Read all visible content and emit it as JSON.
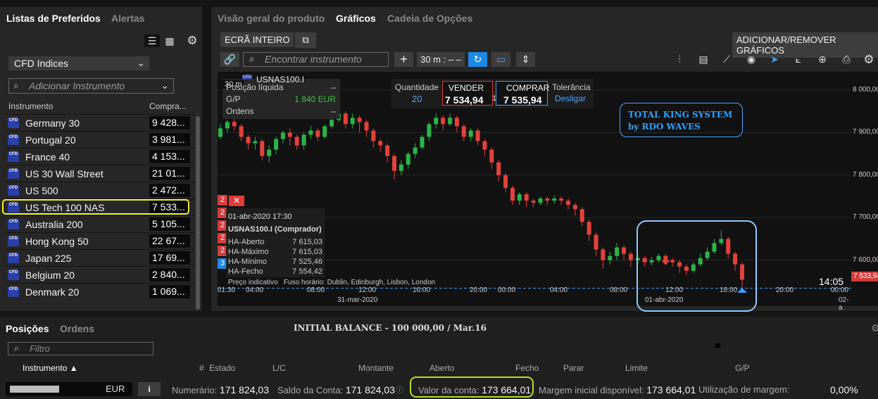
{
  "left": {
    "tabs": [
      "Listas de Preferidos",
      "Alertas"
    ],
    "list_select": "CFD Indices",
    "search_placeholder": "Adicionar Instrumento",
    "col_instrument": "Instrumento",
    "col_buy": "Compra...",
    "cfd_badge": "CFD",
    "items": [
      {
        "name": "Germany 30",
        "price": "9 428..."
      },
      {
        "name": "Portugal 20",
        "price": "3 981..."
      },
      {
        "name": "France 40",
        "price": "4 153..."
      },
      {
        "name": "US 30 Wall Street",
        "price": "21 01..."
      },
      {
        "name": "US 500",
        "price": "2 472..."
      },
      {
        "name": "US Tech 100 NAS",
        "price": "7 533..."
      },
      {
        "name": "Australia 200",
        "price": "5 105..."
      },
      {
        "name": "Hong Kong 50",
        "price": "22 67..."
      },
      {
        "name": "Japan 225",
        "price": "17 69..."
      },
      {
        "name": "Belgium 20",
        "price": "2 840..."
      },
      {
        "name": "Denmark 20",
        "price": "1 069..."
      }
    ]
  },
  "right": {
    "tabs": [
      "Visão geral do produto",
      "Gráficos",
      "Cadeia de Opções"
    ],
    "fullscreen_label": "ECRÃ INTEIRO",
    "add_remove_label": "ADICIONAR/REMOVER GRÁFICOS",
    "search_placeholder": "Encontrar instrumento",
    "interval": "30 m : – –",
    "symbol": "USNAS100.I",
    "symbol_interval": "30 m",
    "pos_label": "Posição líquida",
    "gp_label": "G/P",
    "gp_value": "1 840 EUR",
    "orders_label": "Ordens",
    "dash": "–",
    "quantity_label": "Quantidade",
    "quantity_value": "20",
    "sell_label": "VENDER",
    "sell_price": "7 534,94",
    "spread": "1",
    "buy_label": "COMPRAR",
    "buy_price": "7 535,94",
    "tolerance_label": "Tolerância",
    "tolerance_value": "Desligar",
    "annotation_line1": "TOTAL KING SYSTEM",
    "annotation_line2": "by RDO WAVES",
    "tooltip": {
      "date": "01-abr-2020 17:30",
      "title": "USNAS100.I (Comprador)",
      "rows": [
        {
          "label": "HA-Aberto",
          "value": "7 615,03"
        },
        {
          "label": "HA-Máximo",
          "value": "7 615,03"
        },
        {
          "label": "HA-Mínimo",
          "value": "7 525,46"
        },
        {
          "label": "HA-Fecho",
          "value": "7 554,42"
        }
      ]
    },
    "footer_note": "Preço indicativo   Fuso horário: Dublin, Edinburgh, Lisbon, London",
    "current_time": "14:05",
    "current_price_tag": "7 533,94",
    "date_labels": [
      "31-mar-2020",
      "01-abr-2020",
      "02-a"
    ],
    "order_markers": [
      "2",
      "2",
      "2",
      "2",
      "2",
      "3"
    ]
  },
  "chart_data": {
    "type": "candlestick",
    "series_name": "USNAS100.I",
    "time_ticks": [
      "01:30",
      "04:00",
      "08:00",
      "12:00",
      "16:00",
      "20:00",
      "00:00",
      "04:00",
      "08:00",
      "12:00",
      "16:00",
      "20:00",
      "00:00"
    ],
    "y_ticks": [
      "8 000,00",
      "7 900,00",
      "7 800,00",
      "7 700,00",
      "7 600,00"
    ],
    "ylim": [
      7530,
      8010
    ],
    "last_price": 7533.94,
    "candles": [
      [
        7890,
        7910,
        7885,
        7920
      ],
      [
        7910,
        7925,
        7900,
        7930
      ],
      [
        7925,
        7915,
        7905,
        7935
      ],
      [
        7915,
        7890,
        7880,
        7920
      ],
      [
        7890,
        7875,
        7860,
        7895
      ],
      [
        7875,
        7880,
        7860,
        7890
      ],
      [
        7880,
        7845,
        7835,
        7885
      ],
      [
        7845,
        7860,
        7830,
        7870
      ],
      [
        7860,
        7885,
        7850,
        7890
      ],
      [
        7885,
        7900,
        7875,
        7905
      ],
      [
        7900,
        7890,
        7870,
        7910
      ],
      [
        7890,
        7870,
        7860,
        7895
      ],
      [
        7870,
        7895,
        7860,
        7900
      ],
      [
        7895,
        7905,
        7885,
        7915
      ],
      [
        7905,
        7890,
        7880,
        7910
      ],
      [
        7890,
        7915,
        7885,
        7920
      ],
      [
        7915,
        7930,
        7910,
        7940
      ],
      [
        7930,
        7945,
        7925,
        7950
      ],
      [
        7945,
        7920,
        7910,
        7950
      ],
      [
        7920,
        7935,
        7910,
        7945
      ],
      [
        7935,
        7925,
        7900,
        7940
      ],
      [
        7925,
        7905,
        7890,
        7930
      ],
      [
        7905,
        7880,
        7865,
        7910
      ],
      [
        7880,
        7870,
        7855,
        7885
      ],
      [
        7870,
        7845,
        7830,
        7875
      ],
      [
        7845,
        7810,
        7790,
        7850
      ],
      [
        7810,
        7825,
        7800,
        7835
      ],
      [
        7825,
        7850,
        7815,
        7855
      ],
      [
        7850,
        7865,
        7840,
        7875
      ],
      [
        7865,
        7890,
        7860,
        7895
      ],
      [
        7890,
        7920,
        7880,
        7925
      ],
      [
        7920,
        7935,
        7910,
        7945
      ],
      [
        7935,
        7920,
        7905,
        7940
      ],
      [
        7920,
        7935,
        7915,
        7945
      ],
      [
        7935,
        7915,
        7900,
        7940
      ],
      [
        7915,
        7890,
        7880,
        7920
      ],
      [
        7890,
        7905,
        7880,
        7910
      ],
      [
        7905,
        7880,
        7870,
        7910
      ],
      [
        7880,
        7860,
        7845,
        7885
      ],
      [
        7860,
        7830,
        7815,
        7865
      ],
      [
        7830,
        7800,
        7785,
        7835
      ],
      [
        7800,
        7770,
        7760,
        7805
      ],
      [
        7770,
        7740,
        7730,
        7775
      ],
      [
        7740,
        7755,
        7730,
        7760
      ],
      [
        7755,
        7740,
        7725,
        7760
      ],
      [
        7740,
        7735,
        7725,
        7745
      ],
      [
        7735,
        7745,
        7730,
        7750
      ],
      [
        7745,
        7740,
        7730,
        7750
      ],
      [
        7740,
        7745,
        7732,
        7752
      ],
      [
        7745,
        7740,
        7730,
        7750
      ],
      [
        7740,
        7730,
        7720,
        7745
      ],
      [
        7730,
        7720,
        7705,
        7735
      ],
      [
        7720,
        7690,
        7680,
        7725
      ],
      [
        7690,
        7660,
        7645,
        7695
      ],
      [
        7660,
        7625,
        7610,
        7665
      ],
      [
        7625,
        7600,
        7580,
        7630
      ],
      [
        7600,
        7610,
        7590,
        7620
      ],
      [
        7610,
        7630,
        7600,
        7640
      ],
      [
        7630,
        7615,
        7600,
        7635
      ],
      [
        7615,
        7600,
        7585,
        7620
      ],
      [
        7600,
        7605,
        7590,
        7612
      ],
      [
        7605,
        7595,
        7585,
        7610
      ],
      [
        7595,
        7600,
        7588,
        7608
      ],
      [
        7600,
        7610,
        7595,
        7615
      ],
      [
        7610,
        7600,
        7590,
        7615
      ],
      [
        7600,
        7595,
        7585,
        7605
      ],
      [
        7595,
        7585,
        7570,
        7600
      ],
      [
        7585,
        7575,
        7565,
        7590
      ],
      [
        7575,
        7590,
        7570,
        7595
      ],
      [
        7590,
        7605,
        7585,
        7615
      ],
      [
        7605,
        7620,
        7600,
        7630
      ],
      [
        7620,
        7640,
        7615,
        7650
      ],
      [
        7640,
        7650,
        7635,
        7670
      ],
      [
        7650,
        7615,
        7605,
        7655
      ],
      [
        7615,
        7590,
        7575,
        7620
      ],
      [
        7590,
        7554,
        7525,
        7595
      ]
    ]
  },
  "bottom": {
    "tabs": [
      "Posições",
      "Ordens"
    ],
    "initial_balance": "INITIAL BALANCE - 100 000,00 / Mar.16",
    "filter_placeholder": "Filtro",
    "columns": [
      "Instrumento ▲",
      "#",
      "Estado",
      "L/C",
      "Montante",
      "Aberto",
      "Fecho",
      "Parar",
      "Limite",
      "G/P"
    ],
    "currency": "EUR",
    "info_btn": "i",
    "numerario_label": "Numerário:",
    "numerario_value": "171 824,03",
    "saldo_label": "Saldo da Conta:",
    "saldo_value": "171 824,03",
    "valor_label": "Valor da conta:",
    "valor_value": "173 664,01",
    "margem_label": "Margem inicial disponível:",
    "margem_value": "173 664,01",
    "util_label": "Utilização de margem:",
    "util_value": "0,00%"
  }
}
